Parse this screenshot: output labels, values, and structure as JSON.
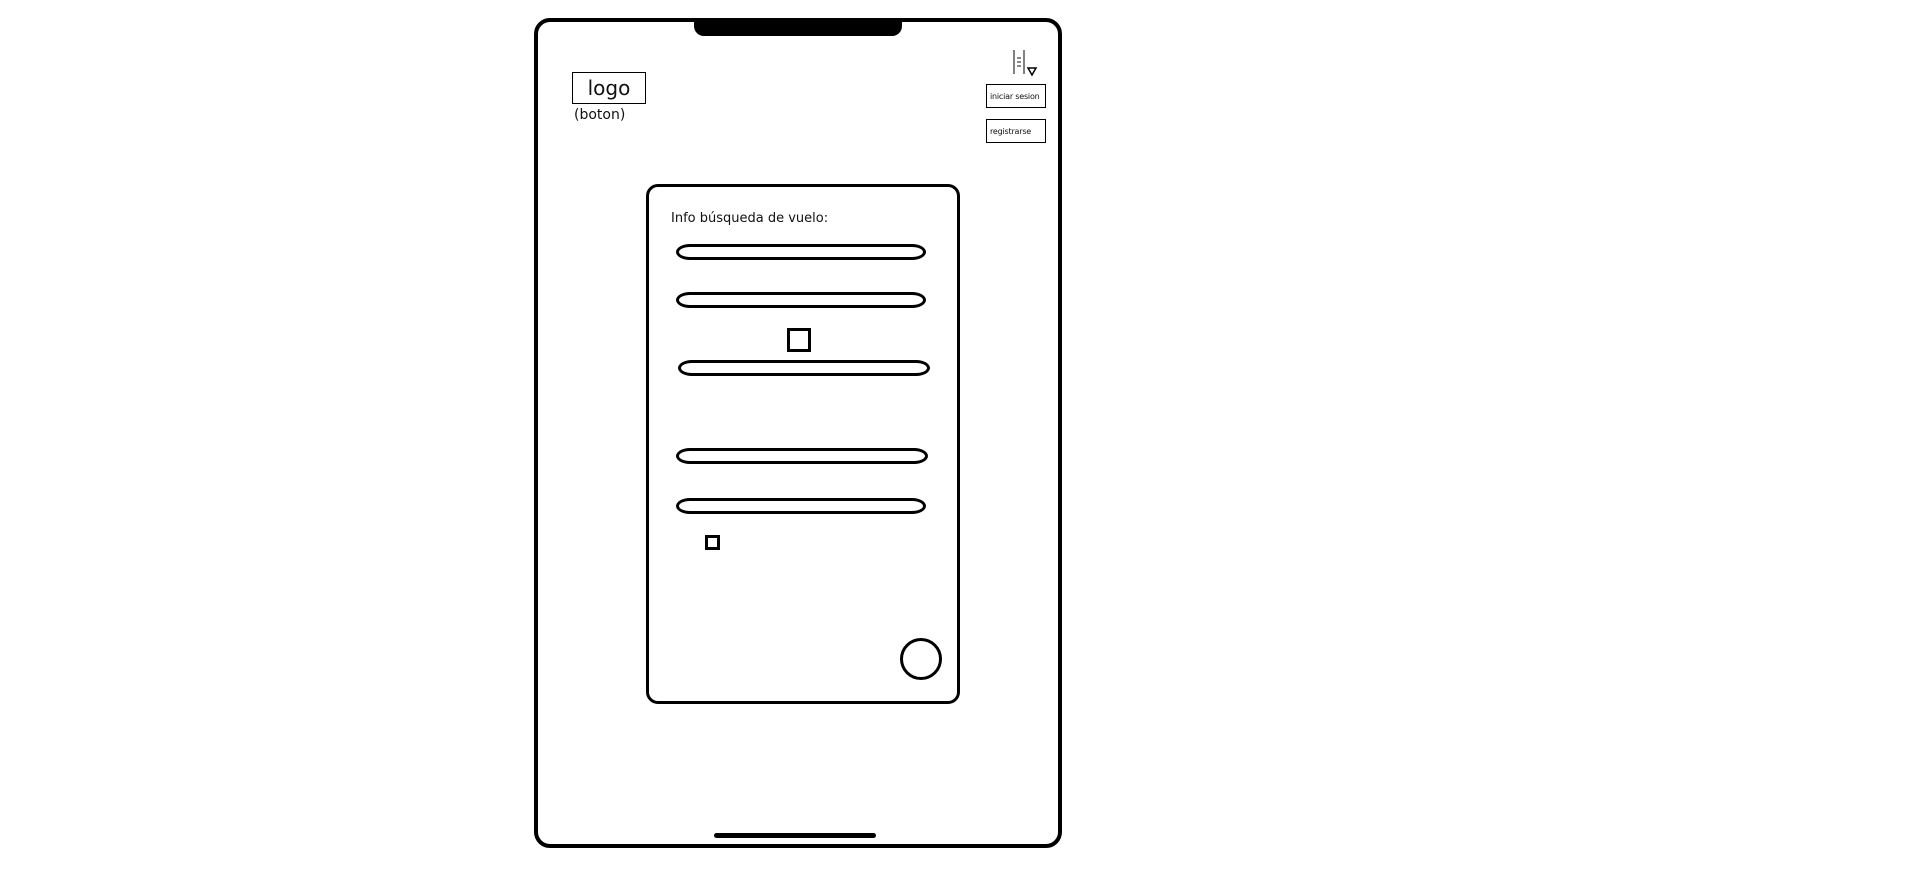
{
  "header": {
    "logo_label": "logo",
    "logo_caption": "(boton)",
    "login_label": "iniciar sesion",
    "register_label": "registrarse",
    "language_icon": "language-selector-icon"
  },
  "search_card": {
    "title": "Info búsqueda de vuelo:",
    "fields": [
      {
        "value": "",
        "placeholder": ""
      },
      {
        "value": "",
        "placeholder": ""
      },
      {
        "value": "",
        "placeholder": ""
      },
      {
        "value": "",
        "placeholder": ""
      },
      {
        "value": "",
        "placeholder": ""
      }
    ],
    "swap_icon": "swap-icon",
    "search_icon": "search-icon"
  }
}
